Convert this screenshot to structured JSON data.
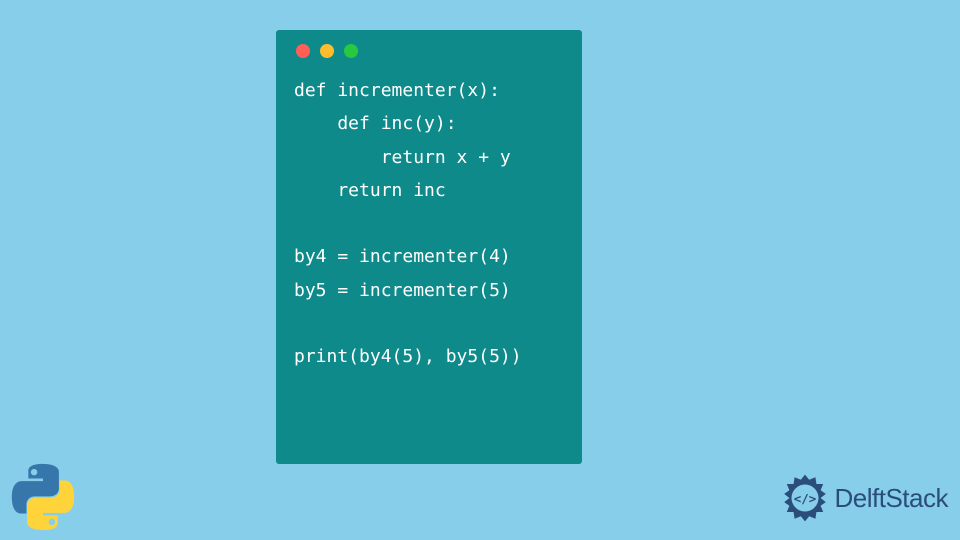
{
  "code": {
    "lines": [
      "def incrementer(x):",
      "    def inc(y):",
      "        return x + y",
      "    return inc",
      "",
      "by4 = incrementer(4)",
      "by5 = incrementer(5)",
      "",
      "print(by4(5), by5(5))"
    ]
  },
  "window": {
    "traffic_colors": {
      "red": "#ff5f56",
      "yellow": "#ffbd2e",
      "green": "#27c93f"
    }
  },
  "branding": {
    "name": "DelftStack"
  }
}
